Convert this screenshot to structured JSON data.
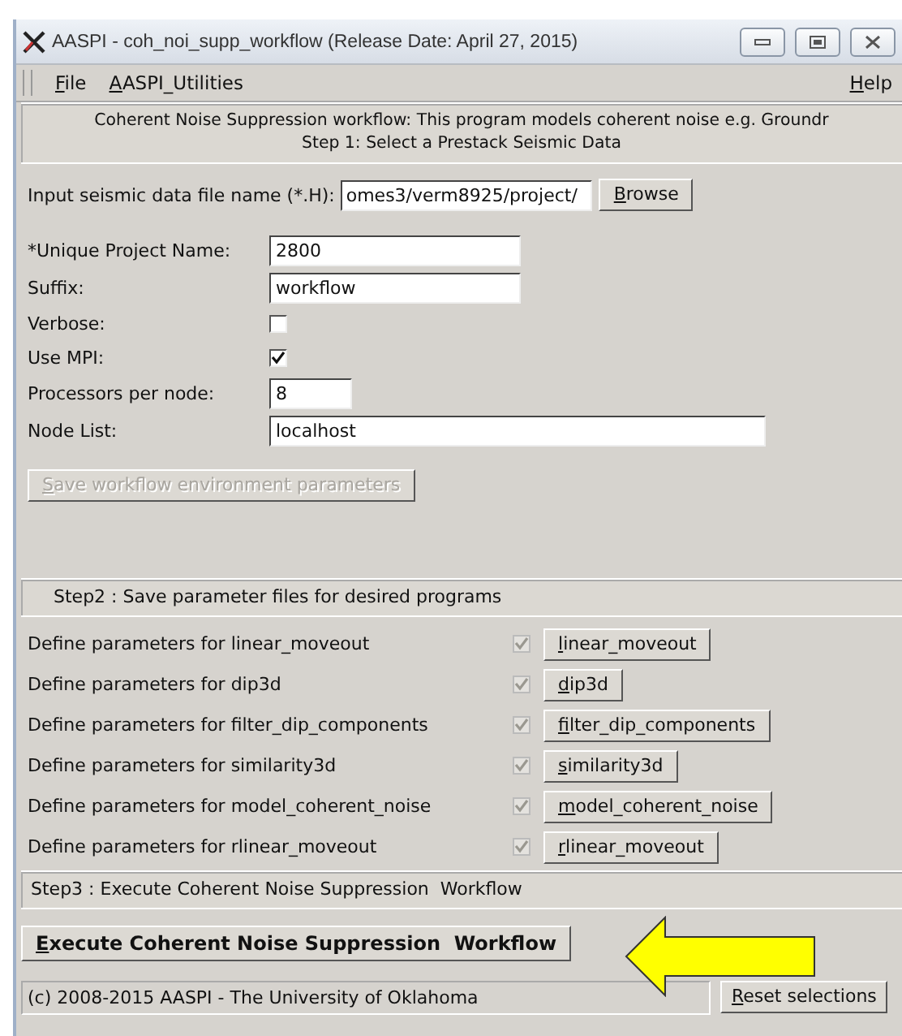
{
  "window": {
    "title": "AASPI - coh_noi_supp_workflow (Release Date: April 27, 2015)"
  },
  "menu": {
    "left": [
      {
        "label": "File"
      },
      {
        "label": "AASPI_Utilities"
      }
    ],
    "right": [
      {
        "label": "Help"
      }
    ]
  },
  "header": {
    "lines": [
      "Coherent Noise Suppression workflow: This program models coherent noise e.g. Groundr",
      "Step 1: Select a Prestack Seismic Data"
    ]
  },
  "input_file": {
    "label": "Input seismic data file name (*.H):",
    "value": "omes3/verm8925/project/",
    "button": "Browse"
  },
  "parameters": [
    {
      "kind": "text",
      "label": "*Unique Project Name:",
      "value": "2800"
    },
    {
      "kind": "text",
      "label": "Suffix:",
      "value": "workflow"
    },
    {
      "kind": "checkbox",
      "label": "Verbose:",
      "checked": false
    },
    {
      "kind": "checkbox",
      "label": "Use MPI:",
      "checked": true
    },
    {
      "kind": "number",
      "label": "Processors per node:",
      "value": "8"
    },
    {
      "kind": "list",
      "label": "Node List:",
      "value": "localhost"
    }
  ],
  "save_button": {
    "label": "Save workflow environment parameters",
    "disabled": true
  },
  "step2": {
    "title": "Step2 : Save parameter files for desired programs"
  },
  "programs": [
    {
      "label": "Define parameters for linear_moveout",
      "checked": true,
      "disabled": true,
      "button": "linear_moveout"
    },
    {
      "label": "Define parameters for dip3d",
      "checked": true,
      "disabled": true,
      "button": "dip3d"
    },
    {
      "label": "Define parameters for filter_dip_components",
      "checked": true,
      "disabled": true,
      "button": "filter_dip_components"
    },
    {
      "label": "Define parameters for similarity3d",
      "checked": true,
      "disabled": true,
      "button": "similarity3d"
    },
    {
      "label": "Define parameters for model_coherent_noise",
      "checked": true,
      "disabled": true,
      "button": "model_coherent_noise"
    },
    {
      "label": "Define parameters for rlinear_moveout",
      "checked": true,
      "disabled": true,
      "button": "rlinear_moveout"
    }
  ],
  "step3": {
    "title": "Step3 : Execute Coherent Noise Suppression  Workflow"
  },
  "execute_button": {
    "label": "Execute Coherent Noise Suppression  Workflow"
  },
  "footer": {
    "copyright": "(c) 2008-2015 AASPI - The University of Oklahoma",
    "reset_button": "Reset selections"
  }
}
